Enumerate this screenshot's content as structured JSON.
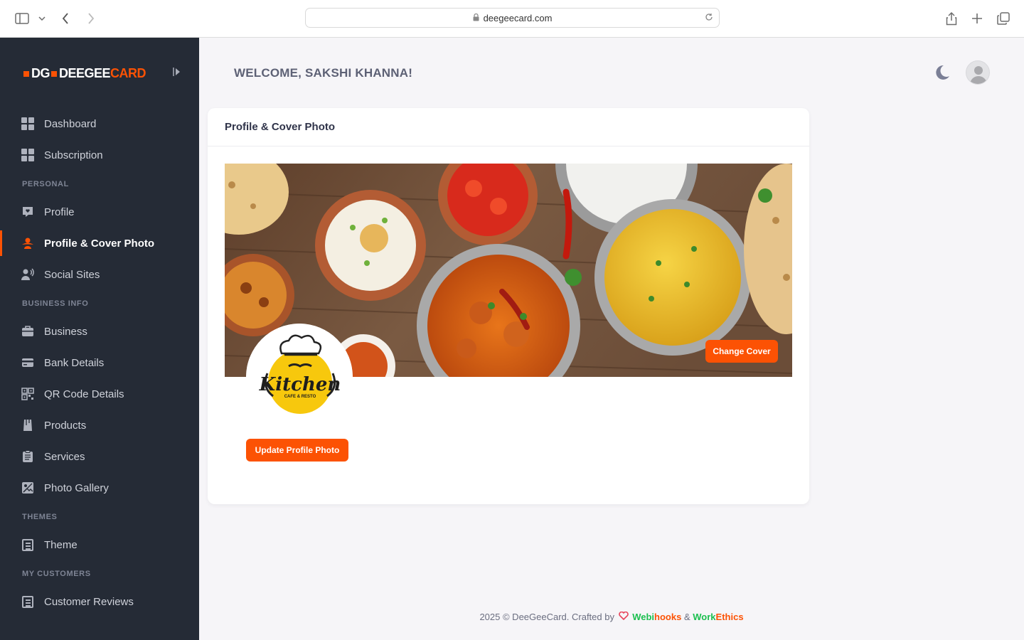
{
  "browser": {
    "url": "deegeecard.com"
  },
  "brand": {
    "logo_mark": "DG",
    "logo_word_1": "DEEGEE",
    "logo_word_2": "CARD",
    "accent_color": "#fc5204",
    "sidebar_bg": "#252b36"
  },
  "sidebar": {
    "items": [
      {
        "label": "Dashboard",
        "icon": "dashboard-icon"
      },
      {
        "label": "Subscription",
        "icon": "subscription-icon"
      },
      {
        "label": "Profile",
        "icon": "profile-icon"
      },
      {
        "label": "Profile & Cover Photo",
        "icon": "cover-photo-icon",
        "active": true
      },
      {
        "label": "Social Sites",
        "icon": "social-sites-icon"
      },
      {
        "label": "Business",
        "icon": "briefcase-icon"
      },
      {
        "label": "Bank Details",
        "icon": "bank-card-icon"
      },
      {
        "label": "QR Code Details",
        "icon": "qr-code-icon"
      },
      {
        "label": "Products",
        "icon": "products-icon"
      },
      {
        "label": "Services",
        "icon": "services-icon"
      },
      {
        "label": "Photo Gallery",
        "icon": "photo-gallery-icon"
      },
      {
        "label": "Theme",
        "icon": "theme-icon"
      },
      {
        "label": "Customer Reviews",
        "icon": "reviews-icon"
      }
    ],
    "sections": {
      "personal": "PERSONAL",
      "business_info": "BUSINESS INFO",
      "themes": "THEMES",
      "my_customers": "MY CUSTOMERS"
    }
  },
  "header": {
    "welcome": "WELCOME, SAKSHI KHANNA!"
  },
  "card": {
    "title": "Profile & Cover Photo",
    "change_cover_label": "Change Cover",
    "update_profile_label": "Update Profile Photo",
    "profile_logo_text": "Kitchen",
    "profile_logo_sub": "CAFE & RESTO"
  },
  "footer": {
    "prefix": "2025 © DeeGeeCard. Crafted by",
    "brand1_a": "Webi",
    "brand1_b": "hooks",
    "amp": "&",
    "brand2_a": "Work",
    "brand2_b": "Ethics"
  }
}
